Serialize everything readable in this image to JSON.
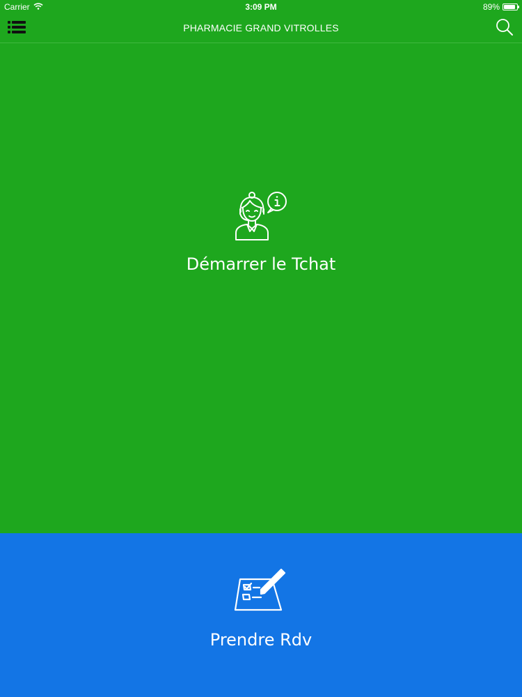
{
  "status_bar": {
    "carrier": "Carrier",
    "time": "3:09 PM",
    "battery_text": "89%",
    "battery_level": 0.89,
    "icons": {
      "wifi": "wifi-icon",
      "battery": "battery-icon"
    }
  },
  "nav_bar": {
    "title": "PHARMACIE GRAND VITROLLES",
    "icons": {
      "menu": "menu-list-icon",
      "search": "search-icon"
    }
  },
  "panels": {
    "chat": {
      "label": "Démarrer le Tchat",
      "icon": "support-agent-info-icon",
      "color": "#1ea71e"
    },
    "appointment": {
      "label": "Prendre Rdv",
      "icon": "checklist-pencil-icon",
      "color": "#1375e5"
    }
  },
  "colors": {
    "primary_green": "#1ea71e",
    "primary_blue": "#1375e5",
    "text": "#ffffff"
  }
}
